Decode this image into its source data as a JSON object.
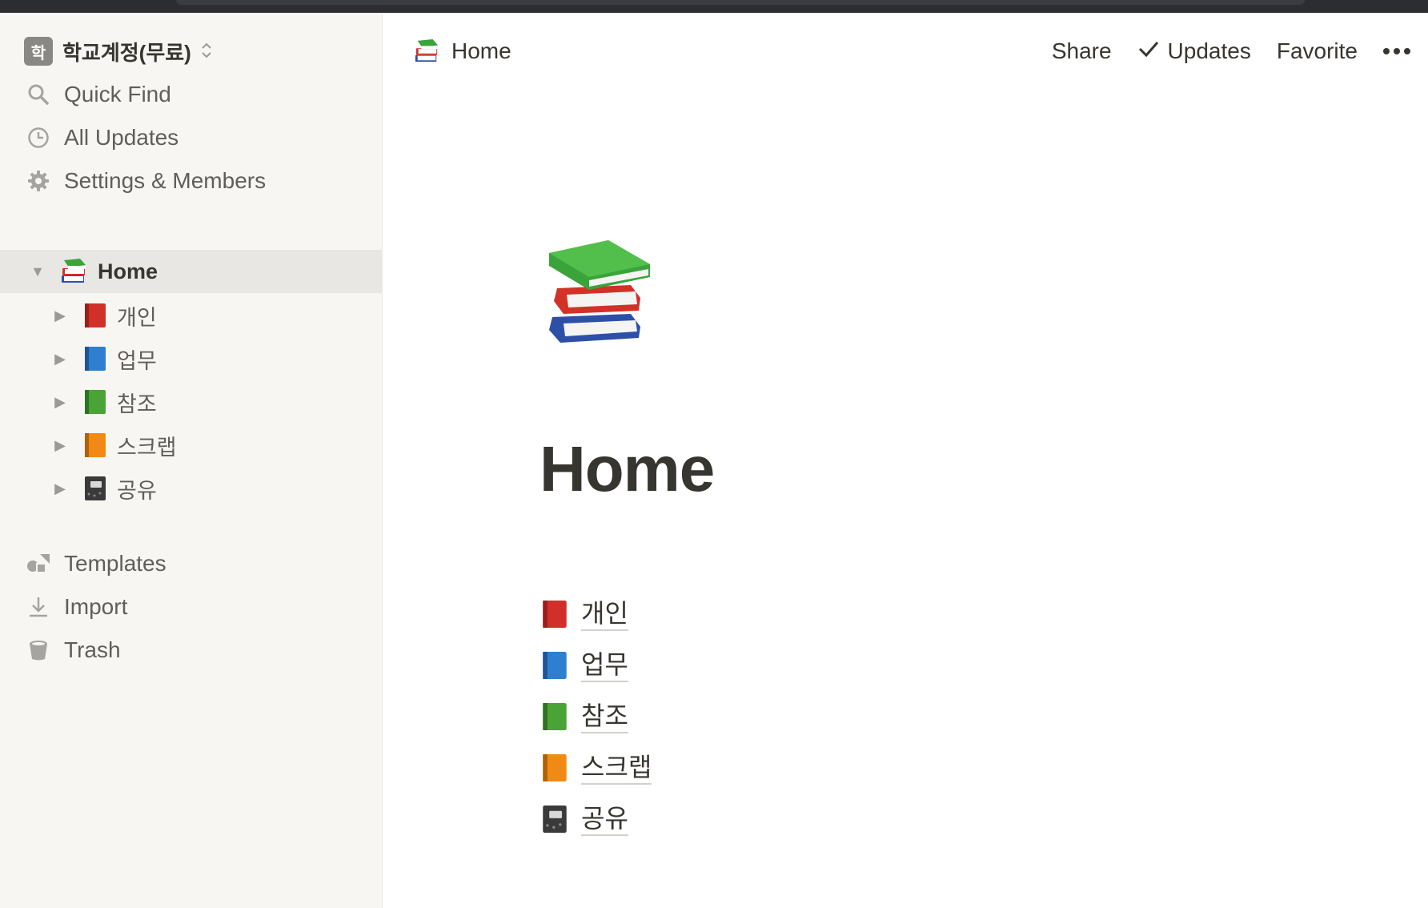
{
  "sidebar": {
    "workspace": {
      "avatar_letter": "학",
      "name": "학교계정(무료)",
      "switch_icon": "chevron-up-down-icon"
    },
    "nav": [
      {
        "label": "Quick Find",
        "icon": "search-icon"
      },
      {
        "label": "All Updates",
        "icon": "clock-icon"
      },
      {
        "label": "Settings & Members",
        "icon": "gear-icon"
      }
    ],
    "tree": {
      "root": {
        "label": "Home",
        "icon": "books-icon",
        "expanded": true
      },
      "children": [
        {
          "label": "개인",
          "icon": "red-book-icon",
          "color": "#d12f2a"
        },
        {
          "label": "업무",
          "icon": "blue-book-icon",
          "color": "#2f7fd1"
        },
        {
          "label": "참조",
          "icon": "green-book-icon",
          "color": "#4aa336"
        },
        {
          "label": "스크랩",
          "icon": "orange-book-icon",
          "color": "#f08a14"
        },
        {
          "label": "공유",
          "icon": "notebook-icon",
          "color": "#3a3a3a"
        }
      ]
    },
    "footer": [
      {
        "label": "Templates",
        "icon": "shapes-icon"
      },
      {
        "label": "Import",
        "icon": "download-icon"
      },
      {
        "label": "Trash",
        "icon": "trash-icon"
      }
    ]
  },
  "topbar": {
    "breadcrumb": "Home",
    "share_label": "Share",
    "updates_label": "Updates",
    "favorite_label": "Favorite"
  },
  "page": {
    "title": "Home",
    "links": [
      {
        "label": "개인",
        "icon": "red-book-icon"
      },
      {
        "label": "업무",
        "icon": "blue-book-icon"
      },
      {
        "label": "참조",
        "icon": "green-book-icon"
      },
      {
        "label": "스크랩",
        "icon": "orange-book-icon"
      },
      {
        "label": "공유",
        "icon": "notebook-icon"
      }
    ]
  },
  "colors": {
    "sidebar_bg": "#f7f6f3",
    "selected_bg": "#e8e7e4",
    "text": "#37352f",
    "muted_text": "#5f5e5b"
  }
}
